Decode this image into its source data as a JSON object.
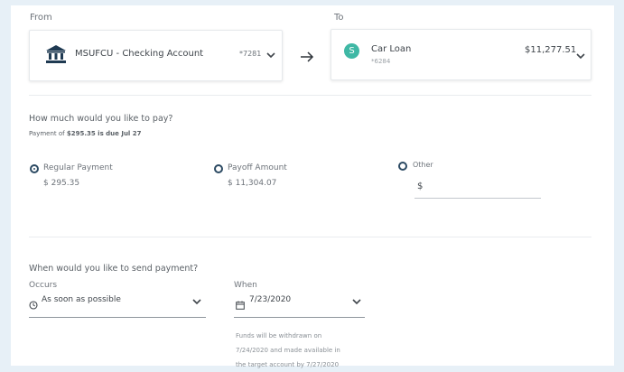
{
  "from": {
    "label": "From",
    "account_name": "MSUFCU - Checking Account",
    "account_mask": "*7281"
  },
  "to": {
    "label": "To",
    "avatar_letter": "S",
    "account_name": "Car Loan",
    "account_mask": "*6284",
    "balance": "$11,277.51"
  },
  "payment": {
    "question": "How much would you like to pay?",
    "due_prefix": "Payment of ",
    "due_amount": "$295.35 is due Jul 27",
    "options": [
      {
        "label": "Regular Payment",
        "amount": "$ 295.35",
        "selected": true
      },
      {
        "label": "Payoff Amount",
        "amount": "$ 11,304.07",
        "selected": false
      },
      {
        "label": "Other",
        "amount": "$",
        "selected": false
      }
    ]
  },
  "schedule": {
    "question": "When would you like to send payment?",
    "occurs_label": "Occurs",
    "occurs_value": "As soon as possible",
    "when_label": "When",
    "when_value": "7/23/2020",
    "note_lines": [
      "Funds will be withdrawn on",
      "7/24/2020 and made available in",
      "the target account by 7/27/2020"
    ]
  },
  "colors": {
    "brand_dark": "#1f3a52",
    "avatar_teal": "#3fb8a5",
    "radio": "#2c4a63"
  }
}
